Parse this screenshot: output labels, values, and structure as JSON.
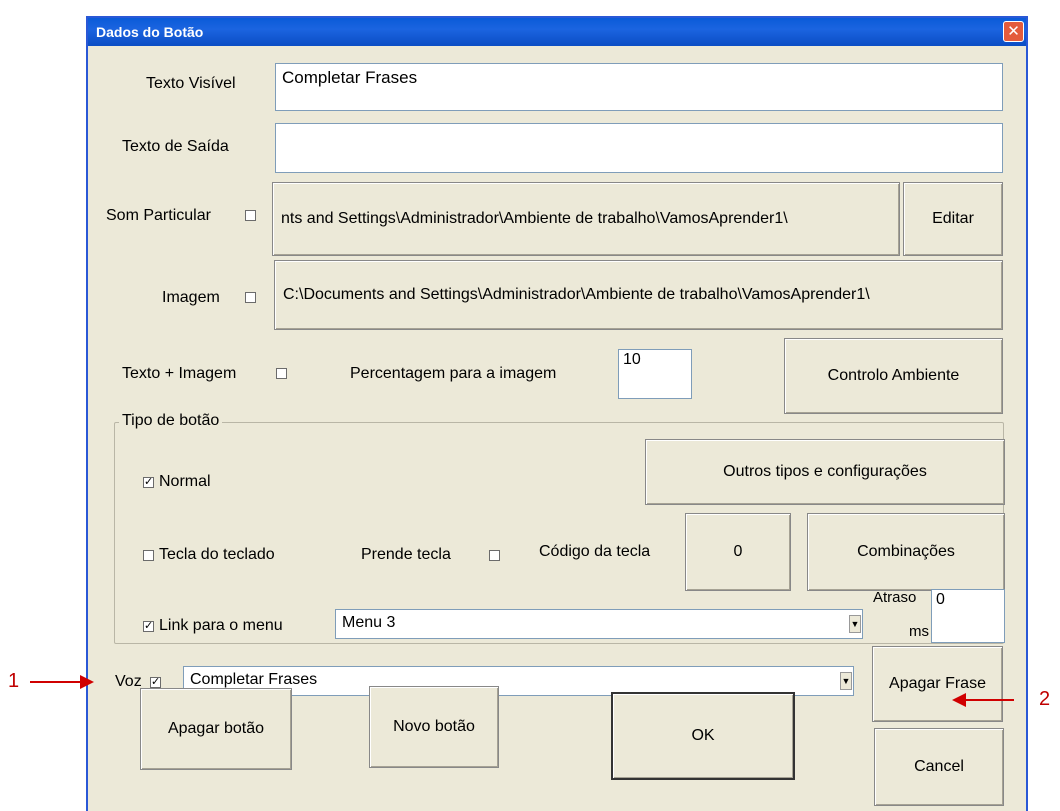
{
  "window": {
    "title": "Dados do Botão",
    "close_glyph": "✕"
  },
  "fields": {
    "texto_visivel": {
      "label": "Texto Visível",
      "value": "Completar Frases"
    },
    "texto_saida": {
      "label": "Texto de Saída",
      "value": ""
    }
  },
  "som": {
    "label": "Som Particular",
    "path": "nts and Settings\\Administrador\\Ambiente de trabalho\\VamosAprender1\\",
    "edit_label": "Editar"
  },
  "imagem": {
    "label": "Imagem",
    "path": "C:\\Documents and Settings\\Administrador\\Ambiente de trabalho\\VamosAprender1\\"
  },
  "texto_imagem": {
    "label": "Texto + Imagem",
    "percent_label": "Percentagem para a  imagem",
    "percent_value": "10",
    "controlo_label": "Controlo Ambiente"
  },
  "tipo": {
    "legend": "Tipo de botão",
    "normal_label": "Normal",
    "outros_label": "Outros tipos e configurações",
    "tecla_label": "Tecla do teclado",
    "prende_label": "Prende tecla",
    "codigo_label": "Código da tecla",
    "codigo_value": "0",
    "combinacoes_label": "Combinações",
    "link_label": "Link para o menu",
    "menu_value": "Menu 3",
    "atraso_label": "Atraso",
    "ms_label": "ms",
    "atraso_value": "0",
    "check_glyph": "✓"
  },
  "voz": {
    "label": "Voz",
    "value": "Completar Frases",
    "apagar_frase_label": "Apagar Frase"
  },
  "buttons": {
    "apagar_botao": "Apagar botão",
    "novo_botao": "Novo botão",
    "ok": "OK",
    "cancel": "Cancel"
  },
  "annotations": {
    "one": "1",
    "two": "2"
  },
  "colors": {
    "titlebar": "#0a5bd8",
    "annotation": "#d00000"
  }
}
